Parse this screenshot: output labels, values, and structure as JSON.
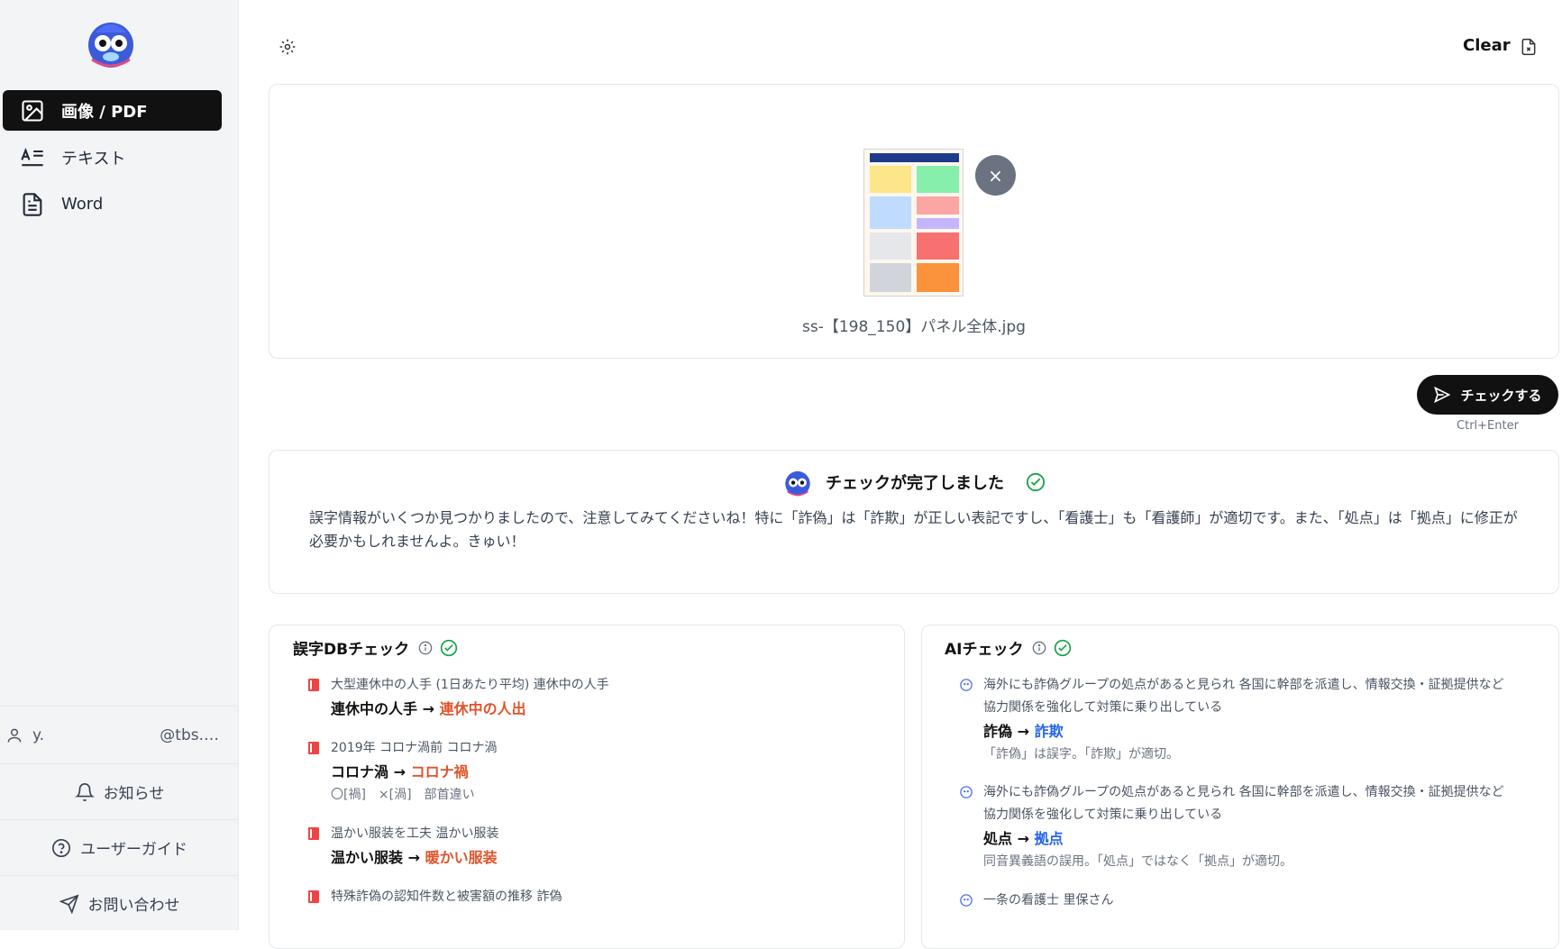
{
  "sidebar": {
    "nav": [
      {
        "label": "画像 / PDF",
        "icon": "image-icon",
        "active": true
      },
      {
        "label": "テキスト",
        "icon": "text-icon",
        "active": false
      },
      {
        "label": "Word",
        "icon": "document-icon",
        "active": false
      }
    ],
    "user": {
      "name": "y.",
      "email": "@tbs.…"
    },
    "links": [
      {
        "label": "お知らせ",
        "icon": "bell-icon"
      },
      {
        "label": "ユーザーガイド",
        "icon": "help-circle-icon"
      },
      {
        "label": "お問い合わせ",
        "icon": "send-icon"
      }
    ]
  },
  "topbar": {
    "clear_label": "Clear"
  },
  "upload": {
    "filename": "ss-【198_150】パネル全体.jpg",
    "remove_label": "×"
  },
  "actions": {
    "check_label": "チェックする",
    "shortcut": "Ctrl+Enter"
  },
  "result": {
    "title": "チェックが完了しました",
    "message": "誤字情報がいくつか見つかりましたので、注意してみてくださいね！特に「詐偽」は「詐欺」が正しい表記ですし、「看護士」も「看護師」が適切です。また、「処点」は「拠点」に修正が必要かもしれませんよ。きゅい！"
  },
  "db_check": {
    "title": "誤字DBチェック",
    "entries": [
      {
        "source": "大型連休中の人手 (1日あたり平均) 連休中の人手",
        "from": "連休中の人手",
        "to": "連休中の人出",
        "note": ""
      },
      {
        "source": "2019年 コロナ渦前 コロナ渦",
        "from": "コロナ渦",
        "to": "コロナ禍",
        "note": "〇[禍]　×[渦]　部首違い"
      },
      {
        "source": "温かい服装を工夫 温かい服装",
        "from": "温かい服装",
        "to": "暖かい服装",
        "note": ""
      },
      {
        "source": "特殊詐偽の認知件数と被害額の推移 詐偽",
        "from": "",
        "to": "",
        "note": ""
      }
    ]
  },
  "ai_check": {
    "title": "AIチェック",
    "entries": [
      {
        "source": "海外にも詐偽グループの処点があると見られ 各国に幹部を派遣し、情報交換・証拠提供など 協力関係を強化して対策に乗り出している",
        "from": "詐偽",
        "to": "詐欺",
        "note": "「詐偽」は誤字。「詐欺」が適切。"
      },
      {
        "source": "海外にも詐偽グループの処点があると見られ 各国に幹部を派遣し、情報交換・証拠提供など 協力関係を強化して対策に乗り出している",
        "from": "処点",
        "to": "拠点",
        "note": "同音異義語の誤用。「処点」ではなく「拠点」が適切。"
      },
      {
        "source": "一条の看護士 里保さん",
        "from": "",
        "to": "",
        "note": ""
      }
    ]
  },
  "arrow": "→",
  "colors": {
    "accent_red": "#e0532b",
    "accent_blue": "#2563eb",
    "success": "#16a34a",
    "dark": "#111111"
  }
}
